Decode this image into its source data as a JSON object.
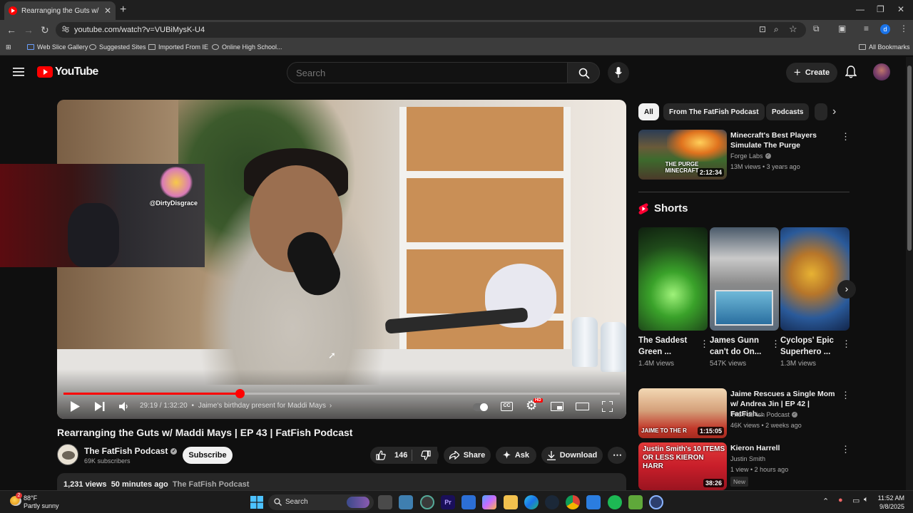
{
  "browser": {
    "tab_title": "Rearranging the Guts w/ Madd",
    "url": "youtube.com/watch?v=VUBiMysK-U4",
    "bookmarks": [
      "Web Slice Gallery",
      "Suggested Sites",
      "Imported From IE",
      "Online High School..."
    ],
    "all_bookmarks": "All Bookmarks",
    "profile_initial": "d"
  },
  "youtube": {
    "logo_text": "YouTube",
    "search_placeholder": "Search",
    "create_label": "Create"
  },
  "player": {
    "overlay_handle": "@DirtyDisgrace",
    "time": "29:19 / 1:32:20",
    "chapter": "Jaime's birthday present for Maddi Mays",
    "progress": 0.317,
    "hd_badge": "HD"
  },
  "video": {
    "title": "Rearranging the Guts w/ Maddi Mays | EP 43 | FatFish Podcast",
    "channel": "The FatFish Podcast",
    "subscribers": "69K subscribers",
    "subscribe_label": "Subscribe",
    "likes": "146",
    "share_label": "Share",
    "ask_label": "Ask",
    "download_label": "Download",
    "views": "1,231 views",
    "age": "50 minutes ago",
    "desc_channel": "The FatFish Podcast"
  },
  "chips": [
    "All",
    "From The FatFish Podcast",
    "Podcasts"
  ],
  "recommendations": [
    {
      "title": "Minecraft's Best Players Simulate The Purge",
      "channel": "Forge Labs",
      "meta": "13M views • 3 years ago",
      "duration": "2:12:34",
      "thumb_text": "THE PURGE MINECRAFT"
    },
    {
      "title": "Jaime Rescues a Single Mom w/ Andrea Jin | EP 42 | FatFish...",
      "channel": "The FatFish Podcast",
      "meta": "46K views • 2 weeks ago",
      "duration": "1:15:05",
      "thumb_text": "JAIME TO THE R"
    },
    {
      "title": "Kieron Harrell",
      "channel": "Justin Smith",
      "meta": "1 view • 2 hours ago",
      "duration": "38:26",
      "badge": "New",
      "thumb_text": "Justin Smith's 10 ITEMS OR LESS KIERON HARR"
    }
  ],
  "shorts": {
    "heading": "Shorts",
    "items": [
      {
        "title": "The Saddest Green ...",
        "views": "1.4M views"
      },
      {
        "title": "James Gunn can't do On...",
        "views": "547K views"
      },
      {
        "title": "Cyclops' Epic Superhero ...",
        "views": "1.3M views"
      }
    ]
  },
  "taskbar": {
    "temp": "88°F",
    "condition": "Partly sunny",
    "search": "Search",
    "time": "11:52 AM",
    "date": "9/8/2025",
    "weather_badge": "2"
  }
}
